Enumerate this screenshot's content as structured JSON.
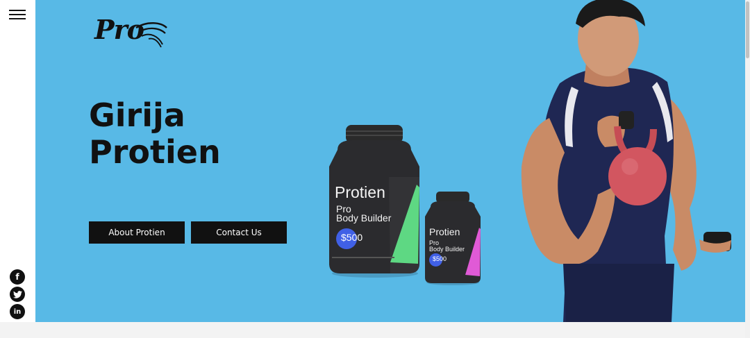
{
  "sidebar": {
    "menu_icon": "hamburger-icon",
    "social": [
      {
        "name": "facebook-icon",
        "glyph": "f"
      },
      {
        "name": "twitter-icon",
        "glyph": "t"
      },
      {
        "name": "linkedin-icon",
        "glyph": "in"
      }
    ]
  },
  "hero": {
    "logo": "Pro",
    "title_line1": "Girija",
    "title_line2": "Protien",
    "about_button": "About Protien",
    "contact_button": "Contact Us",
    "background_color": "#58b9e6"
  },
  "product_large": {
    "brand": "Protien",
    "line1": "Pro",
    "line2": "Body Builder",
    "price": "$500"
  },
  "product_small": {
    "brand": "Protien",
    "line1": "Pro",
    "line2": "Body Builder",
    "price": "$500"
  }
}
